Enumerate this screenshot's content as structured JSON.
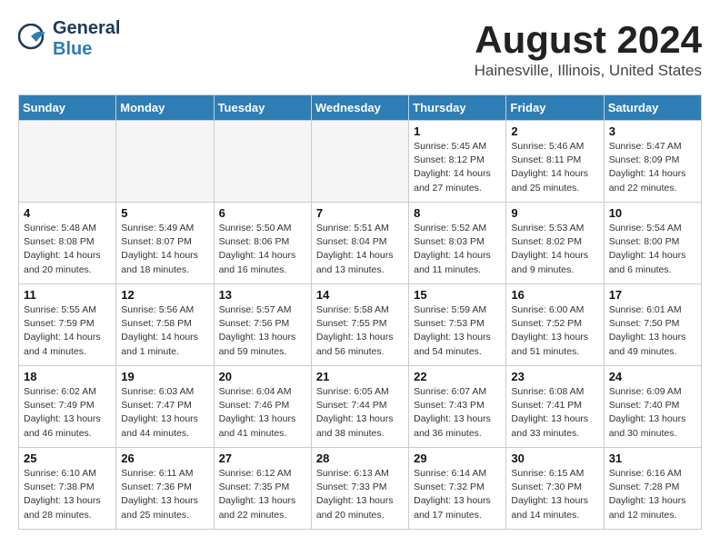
{
  "header": {
    "logo_general": "General",
    "logo_blue": "Blue",
    "month_year": "August 2024",
    "location": "Hainesville, Illinois, United States"
  },
  "weekdays": [
    "Sunday",
    "Monday",
    "Tuesday",
    "Wednesday",
    "Thursday",
    "Friday",
    "Saturday"
  ],
  "weeks": [
    [
      {
        "day": "",
        "empty": true
      },
      {
        "day": "",
        "empty": true
      },
      {
        "day": "",
        "empty": true
      },
      {
        "day": "",
        "empty": true
      },
      {
        "day": "1",
        "sunrise": "5:45 AM",
        "sunset": "8:12 PM",
        "daylight": "14 hours and 27 minutes."
      },
      {
        "day": "2",
        "sunrise": "5:46 AM",
        "sunset": "8:11 PM",
        "daylight": "14 hours and 25 minutes."
      },
      {
        "day": "3",
        "sunrise": "5:47 AM",
        "sunset": "8:09 PM",
        "daylight": "14 hours and 22 minutes."
      }
    ],
    [
      {
        "day": "4",
        "sunrise": "5:48 AM",
        "sunset": "8:08 PM",
        "daylight": "14 hours and 20 minutes."
      },
      {
        "day": "5",
        "sunrise": "5:49 AM",
        "sunset": "8:07 PM",
        "daylight": "14 hours and 18 minutes."
      },
      {
        "day": "6",
        "sunrise": "5:50 AM",
        "sunset": "8:06 PM",
        "daylight": "14 hours and 16 minutes."
      },
      {
        "day": "7",
        "sunrise": "5:51 AM",
        "sunset": "8:04 PM",
        "daylight": "14 hours and 13 minutes."
      },
      {
        "day": "8",
        "sunrise": "5:52 AM",
        "sunset": "8:03 PM",
        "daylight": "14 hours and 11 minutes."
      },
      {
        "day": "9",
        "sunrise": "5:53 AM",
        "sunset": "8:02 PM",
        "daylight": "14 hours and 9 minutes."
      },
      {
        "day": "10",
        "sunrise": "5:54 AM",
        "sunset": "8:00 PM",
        "daylight": "14 hours and 6 minutes."
      }
    ],
    [
      {
        "day": "11",
        "sunrise": "5:55 AM",
        "sunset": "7:59 PM",
        "daylight": "14 hours and 4 minutes."
      },
      {
        "day": "12",
        "sunrise": "5:56 AM",
        "sunset": "7:58 PM",
        "daylight": "14 hours and 1 minute."
      },
      {
        "day": "13",
        "sunrise": "5:57 AM",
        "sunset": "7:56 PM",
        "daylight": "13 hours and 59 minutes."
      },
      {
        "day": "14",
        "sunrise": "5:58 AM",
        "sunset": "7:55 PM",
        "daylight": "13 hours and 56 minutes."
      },
      {
        "day": "15",
        "sunrise": "5:59 AM",
        "sunset": "7:53 PM",
        "daylight": "13 hours and 54 minutes."
      },
      {
        "day": "16",
        "sunrise": "6:00 AM",
        "sunset": "7:52 PM",
        "daylight": "13 hours and 51 minutes."
      },
      {
        "day": "17",
        "sunrise": "6:01 AM",
        "sunset": "7:50 PM",
        "daylight": "13 hours and 49 minutes."
      }
    ],
    [
      {
        "day": "18",
        "sunrise": "6:02 AM",
        "sunset": "7:49 PM",
        "daylight": "13 hours and 46 minutes."
      },
      {
        "day": "19",
        "sunrise": "6:03 AM",
        "sunset": "7:47 PM",
        "daylight": "13 hours and 44 minutes."
      },
      {
        "day": "20",
        "sunrise": "6:04 AM",
        "sunset": "7:46 PM",
        "daylight": "13 hours and 41 minutes."
      },
      {
        "day": "21",
        "sunrise": "6:05 AM",
        "sunset": "7:44 PM",
        "daylight": "13 hours and 38 minutes."
      },
      {
        "day": "22",
        "sunrise": "6:07 AM",
        "sunset": "7:43 PM",
        "daylight": "13 hours and 36 minutes."
      },
      {
        "day": "23",
        "sunrise": "6:08 AM",
        "sunset": "7:41 PM",
        "daylight": "13 hours and 33 minutes."
      },
      {
        "day": "24",
        "sunrise": "6:09 AM",
        "sunset": "7:40 PM",
        "daylight": "13 hours and 30 minutes."
      }
    ],
    [
      {
        "day": "25",
        "sunrise": "6:10 AM",
        "sunset": "7:38 PM",
        "daylight": "13 hours and 28 minutes."
      },
      {
        "day": "26",
        "sunrise": "6:11 AM",
        "sunset": "7:36 PM",
        "daylight": "13 hours and 25 minutes."
      },
      {
        "day": "27",
        "sunrise": "6:12 AM",
        "sunset": "7:35 PM",
        "daylight": "13 hours and 22 minutes."
      },
      {
        "day": "28",
        "sunrise": "6:13 AM",
        "sunset": "7:33 PM",
        "daylight": "13 hours and 20 minutes."
      },
      {
        "day": "29",
        "sunrise": "6:14 AM",
        "sunset": "7:32 PM",
        "daylight": "13 hours and 17 minutes."
      },
      {
        "day": "30",
        "sunrise": "6:15 AM",
        "sunset": "7:30 PM",
        "daylight": "13 hours and 14 minutes."
      },
      {
        "day": "31",
        "sunrise": "6:16 AM",
        "sunset": "7:28 PM",
        "daylight": "13 hours and 12 minutes."
      }
    ]
  ]
}
